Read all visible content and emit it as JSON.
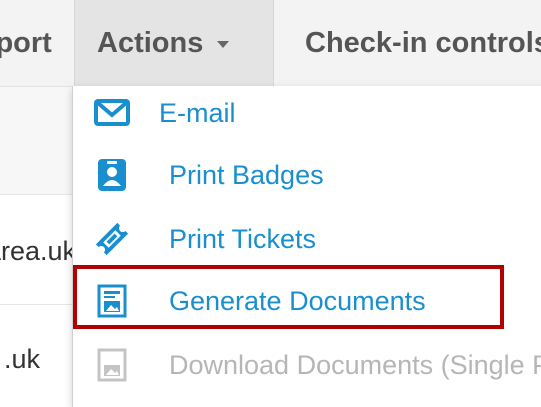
{
  "nav": {
    "export_label": "Export",
    "actions_label": "Actions",
    "checkin_label": "Check-in controls"
  },
  "table": {
    "row2_email": "area.uk",
    "row3_email": ".uk"
  },
  "menu": {
    "items": [
      {
        "label": "E-mail",
        "icon": "envelope-icon",
        "enabled": true
      },
      {
        "label": "Print Badges",
        "icon": "badge-icon",
        "enabled": true
      },
      {
        "label": "Print Tickets",
        "icon": "ticket-icon",
        "enabled": true
      },
      {
        "label": "Generate Documents",
        "icon": "document-icon",
        "enabled": true,
        "highlighted": true
      },
      {
        "label": "Download Documents (Single PDF)",
        "icon": "document-icon",
        "enabled": false
      }
    ]
  },
  "colors": {
    "link": "#1a8fcf",
    "disabled": "#b6b6b6",
    "highlight": "#b00000"
  }
}
